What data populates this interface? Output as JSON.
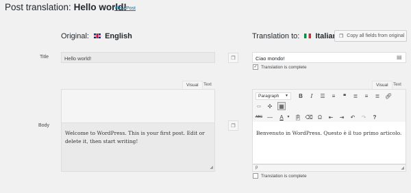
{
  "header": {
    "title_prefix": "Post translation:",
    "title_post": "Hello world!",
    "view_post": "View Post"
  },
  "original": {
    "label": "Original:",
    "language": "English",
    "flag_icon": "uk-flag-icon"
  },
  "translation": {
    "label": "Translation to:",
    "language": "Italian",
    "flag_icon": "italy-flag-icon",
    "copy_all_label": "Copy all fields from original"
  },
  "title_row": {
    "label": "Title",
    "original_value": "Hello world!",
    "translated_value": "Ciao mondo!",
    "complete_label": "Translation is complete",
    "complete_checked": true
  },
  "body_row": {
    "label": "Body",
    "original_tabs": [
      "Visual",
      "Text"
    ],
    "translated_tabs": [
      "Visual",
      "Text"
    ],
    "original_text": "Welcome to WordPress. This is your first post. Edit or delete it, then start writing!",
    "translated_text": "Benvenuto in WordPress. Questo è il tuo primo articolo.",
    "format_select": "Paragraph",
    "status_path": "p",
    "complete_label": "Translation is complete",
    "complete_checked": false
  },
  "colors": {
    "background": "#f1f1f1",
    "link": "#0073aa",
    "field_border": "#dddddd",
    "readonly_field": "#eaeaea"
  }
}
